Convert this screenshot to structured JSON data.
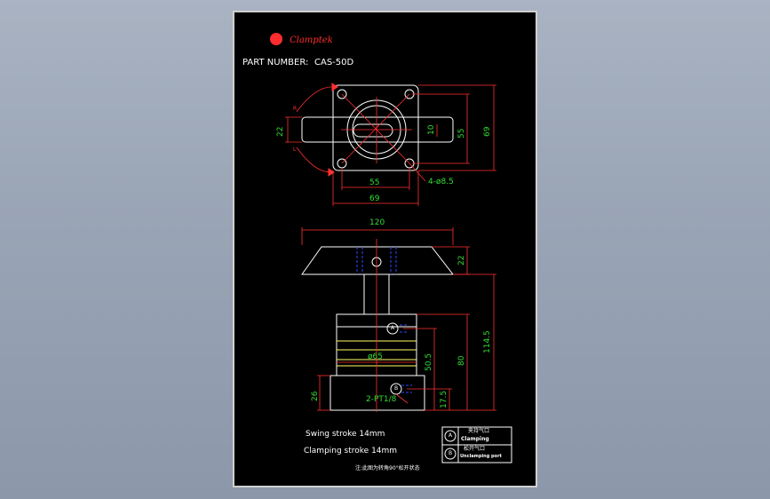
{
  "brand": {
    "name": "Clamptek"
  },
  "header": {
    "part_number_label": "PART NUMBER:",
    "part_number": "CAS-50D"
  },
  "top_view": {
    "dim_height": "69",
    "dim_hole_spacing_v": "55",
    "dim_arm_width": "22",
    "dim_slot": "10",
    "dim_hole_spacing_h": "55",
    "dim_width": "69",
    "hole_callout": "4-ø8.5",
    "rot_right": "R",
    "rot_left": "L"
  },
  "side_view": {
    "dim_arm_length": "120",
    "dim_arm_thickness": "22",
    "dim_total_height": "114.5",
    "dim_body_height": "80",
    "dim_port_distance": "50.5",
    "dim_port_b": "17.5",
    "dim_base": "26",
    "dim_diameter": "ø65",
    "port_callout": "2-PT1/8",
    "port_a": "A",
    "port_b": "B"
  },
  "notes": {
    "swing_stroke": "Swing stroke 14mm",
    "clamping_stroke": "Clamping stroke 14mm",
    "legend_a_cn": "夹持气口",
    "legend_a_en": "Clamping",
    "legend_b_cn": "松开气口",
    "legend_b_en": "Unclamping port",
    "footnote": "注:此图为转角90°松开状态"
  },
  "colors": {
    "background": "#000000",
    "outline": "#ffffff",
    "dimension": "#33dd33",
    "dimension_lines": "#ff3030",
    "hidden": "#2a4cff",
    "highlight": "#ffff66"
  }
}
